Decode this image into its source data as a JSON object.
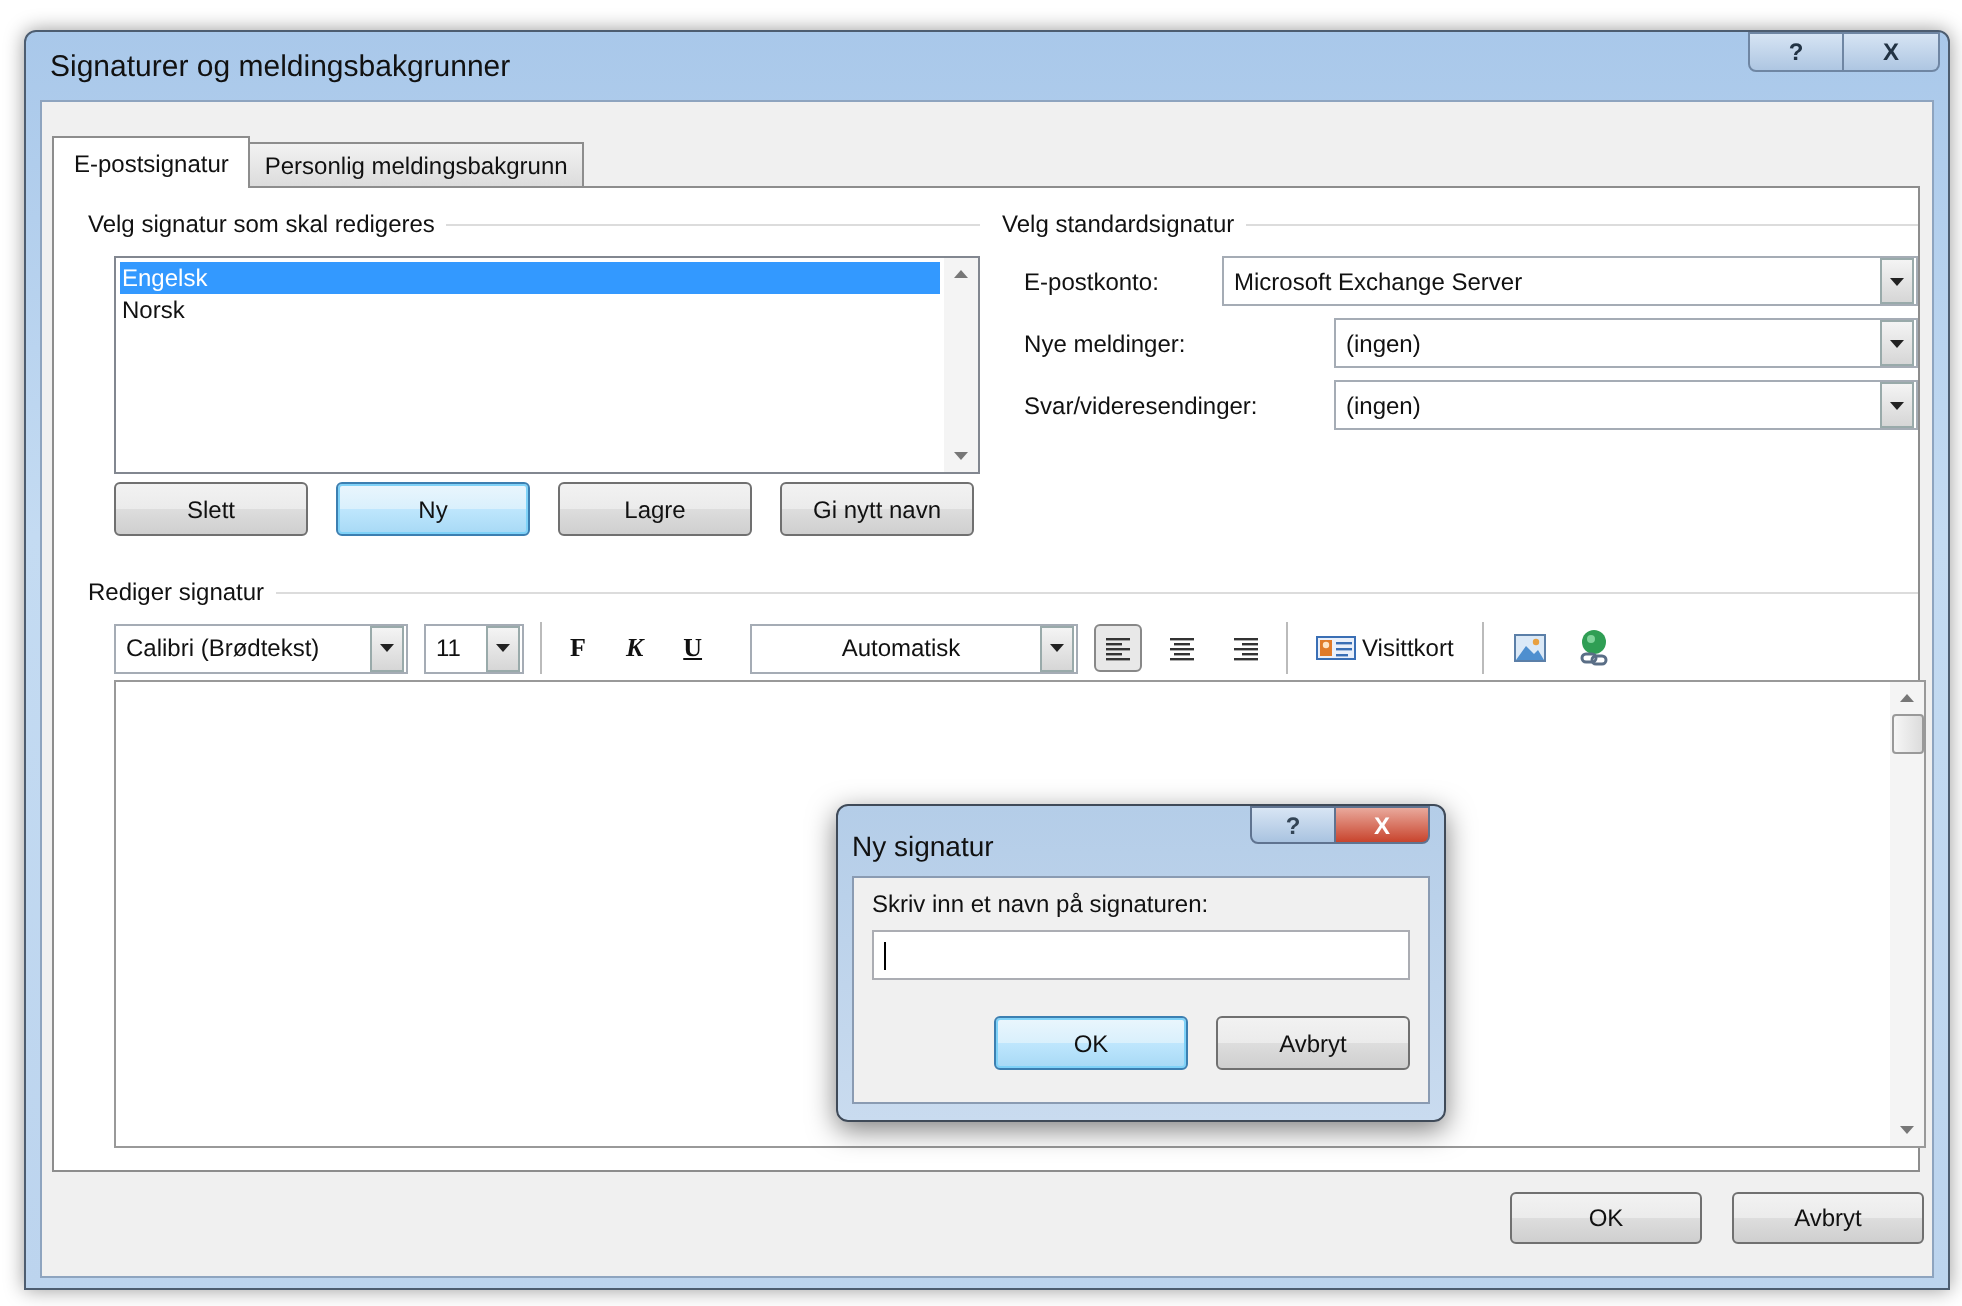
{
  "window": {
    "title": "Signaturer og meldingsbakgrunner",
    "help_button": "?",
    "close_button": "X"
  },
  "tabs": [
    {
      "label": "E-postsignatur",
      "selected": true
    },
    {
      "label": "Personlig meldingsbakgrunn",
      "selected": false
    }
  ],
  "signature_picker": {
    "label": "Velg signatur som skal redigeres",
    "items": [
      {
        "label": "Engelsk",
        "selected": true
      },
      {
        "label": "Norsk",
        "selected": false
      }
    ],
    "buttons": [
      {
        "label": "Slett",
        "focused": false
      },
      {
        "label": "Ny",
        "focused": true
      },
      {
        "label": "Lagre",
        "focused": false
      },
      {
        "label": "Gi nytt navn",
        "focused": false
      }
    ]
  },
  "default_signature": {
    "label": "Velg standardsignatur",
    "fields": [
      {
        "label": "E-postkonto:",
        "value": "Microsoft Exchange Server"
      },
      {
        "label": "Nye meldinger:",
        "value": "(ingen)"
      },
      {
        "label": "Svar/videresendinger:",
        "value": "(ingen)"
      }
    ]
  },
  "editor": {
    "label": "Rediger signatur",
    "toolbar": {
      "font": "Calibri (Brødtekst)",
      "size": "11",
      "bold": "F",
      "italic": "K",
      "underline": "U",
      "font_color": "Automatisk",
      "alignments": [
        {
          "kind": "left",
          "selected": true
        },
        {
          "kind": "center",
          "selected": false
        },
        {
          "kind": "right",
          "selected": false
        }
      ],
      "business_card": "Visittkort"
    }
  },
  "dialog": {
    "title": "Ny signatur",
    "help_button": "?",
    "close_button": "X",
    "prompt": "Skriv inn et navn på signaturen:",
    "buttons": [
      {
        "label": "OK",
        "focused": true
      },
      {
        "label": "Avbryt",
        "focused": false
      }
    ]
  },
  "footer_buttons": [
    "OK",
    "Avbryt"
  ]
}
